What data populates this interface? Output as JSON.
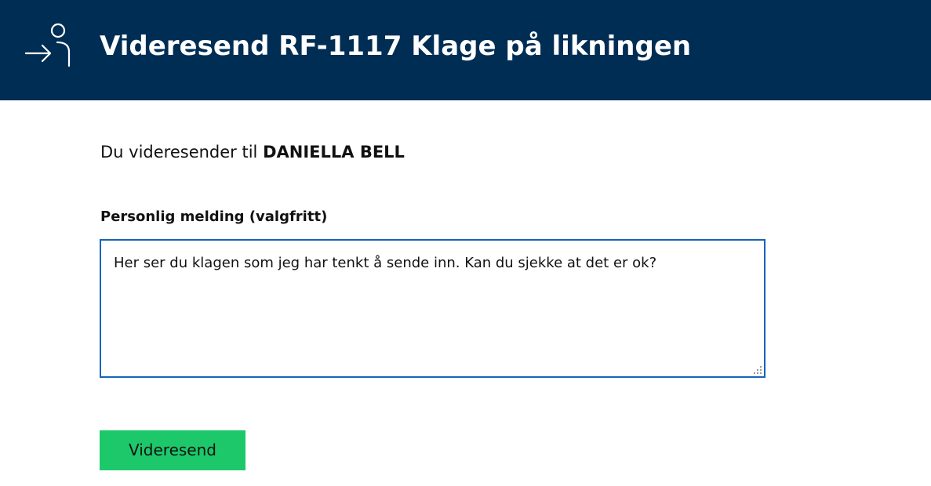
{
  "header": {
    "title": "Videresend RF-1117 Klage på likningen",
    "icon": "forward-person-icon",
    "background_color": "#002d54"
  },
  "recipient": {
    "prefix": "Du videresender til ",
    "name": "DANIELLA BELL"
  },
  "message": {
    "label": "Personlig melding (valgfritt)",
    "value": "Her ser du klagen som jeg har tenkt å sende inn. Kan du sjekke at det er ok?"
  },
  "actions": {
    "send_label": "Videresend",
    "send_color": "#1dc86b"
  }
}
